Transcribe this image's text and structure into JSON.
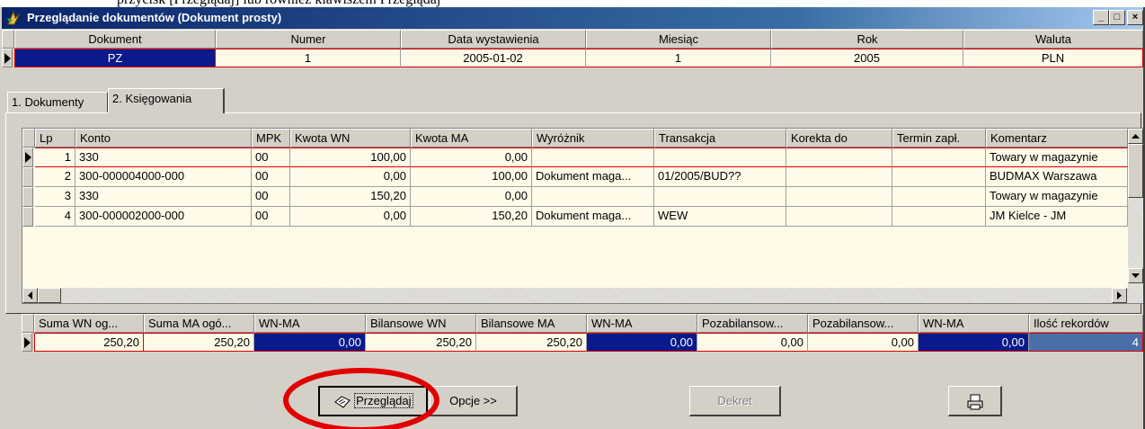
{
  "window": {
    "title": "Przeglądanie dokumentów (Dokument prosty)"
  },
  "top_clip_text": "przycisk [Przeglądaj] lub również klawiszem Przeglądaj",
  "header_grid": {
    "columns": [
      "Dokument",
      "Numer",
      "Data wystawienia",
      "Miesiąc",
      "Rok",
      "Waluta"
    ],
    "row": [
      "PZ",
      "1",
      "2005-01-02",
      "1",
      "2005",
      "PLN"
    ]
  },
  "tabs": [
    "1. Dokumenty",
    "2. Księgowania"
  ],
  "entries": {
    "columns": [
      "Lp",
      "Konto",
      "MPK",
      "Kwota WN",
      "Kwota MA",
      "Wyróżnik",
      "Transakcja",
      "Korekta do",
      "Termin zapł.",
      "Komentarz"
    ],
    "rows": [
      [
        "1",
        "330",
        "00",
        "100,00",
        "0,00",
        "",
        "",
        "",
        "",
        "Towary w magazynie"
      ],
      [
        "2",
        "300-000004000-000",
        "00",
        "0,00",
        "100,00",
        "Dokument maga...",
        "01/2005/BUD??",
        "",
        "",
        "BUDMAX Warszawa"
      ],
      [
        "3",
        "330",
        "00",
        "150,20",
        "0,00",
        "",
        "",
        "",
        "",
        "Towary w magazynie"
      ],
      [
        "4",
        "300-000002000-000",
        "00",
        "0,00",
        "150,20",
        "Dokument maga...",
        "WEW",
        "",
        "",
        "JM Kielce - JM"
      ]
    ]
  },
  "summary": {
    "columns": [
      "Suma WN og...",
      "Suma MA ogó...",
      "WN-MA",
      "Bilansowe WN",
      "Bilansowe MA",
      "WN-MA",
      "Pozabilansow...",
      "Pozabilansow...",
      "WN-MA",
      "Ilość rekordów"
    ],
    "row": [
      "250,20",
      "250,20",
      "0,00",
      "250,20",
      "250,20",
      "0,00",
      "0,00",
      "0,00",
      "0,00",
      "4"
    ]
  },
  "buttons": {
    "browse": "Przeglądaj",
    "options": "Opcje >>",
    "decree": "Dekret"
  },
  "colors": {
    "selected_navy": "#0a1a8c",
    "cream": "#fffbe8",
    "highlight_red": "#e00000",
    "blue_cell": "#4a6fa8"
  }
}
